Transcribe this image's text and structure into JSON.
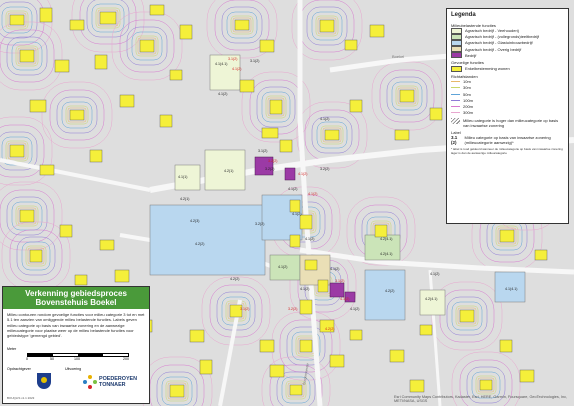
{
  "map": {
    "road_label": "Boekel",
    "street_label": "Burgemeester",
    "parcel_labels": [
      "4.1(1)",
      "4.2(1)",
      "4.2(3)",
      "3.1(2)",
      "4.1(4.1)",
      "4.1(2)",
      "4.2(2)",
      "4.1(2)",
      "4.2(4.1)",
      "4.1(2)",
      "4.1(2)",
      "3.2(2)",
      "4.1(2)",
      "4.1(2)",
      "4.1(2)",
      "4.2(4.1)",
      "4.2(4.1)",
      "4.1(2)",
      "4.1(2)",
      "4.2(2)",
      "4.1(4.1)",
      "3.2(2)",
      "3.2(2)",
      "3.1(2)",
      "4.2(1)",
      "4.1(2)",
      "4.2(2)"
    ],
    "red_labels": [
      "3.1(2)",
      "4.1(2)",
      "3.2(2)",
      "4.1(2)",
      "3.1(2)",
      "4.1(2)",
      "3.2(2)",
      "4.2(2)",
      "3.1(2)",
      "4.1(2)"
    ],
    "colors": {
      "woning": "#f5ef3a",
      "veehouderij": "#eef5d6",
      "volle_grond": "#cbe4b8",
      "glastuinbouw": "#b9d7ef",
      "overig": "#eadfb6",
      "bedrijf": "#9b3aa5",
      "c10": "#e6b96a",
      "c30": "#c8d86a",
      "c50": "#5fa4d8",
      "c100": "#8f7bd6",
      "c200": "#d77ad0",
      "c300": "#e8a7cf",
      "road": "#f6f6f6",
      "land": "#dcdcdc"
    }
  },
  "legend": {
    "title": "Legenda",
    "section1_title": "Milieubelastende functies",
    "milieu_items": [
      {
        "label": "Agrarisch bedrijf - Veehouderij",
        "color": "#eef5d6"
      },
      {
        "label": "Agrarisch bedrijf - (vollegronds)teeltbedrijf",
        "color": "#cbe4b8"
      },
      {
        "label": "Agrarisch bedrijf - Glastuinbouwbedrijf",
        "color": "#b9d7ef"
      },
      {
        "label": "Agrarisch bedrijf - Overig bedrijf",
        "color": "#eadfb6"
      },
      {
        "label": "Bedrijf",
        "color": "#9b3aa5"
      }
    ],
    "section2_title": "Gevoelige functies",
    "gevoelig_item": {
      "label": "Enkelbestemming wonen",
      "color": "#f5ef3a"
    },
    "section3_title": "Richtafstanden",
    "distances": [
      {
        "label": "10m",
        "color": "#e6b96a"
      },
      {
        "label": "30m",
        "color": "#c8d86a"
      },
      {
        "label": "50m",
        "color": "#5fa4d8"
      },
      {
        "label": "100m",
        "color": "#8f7bd6"
      },
      {
        "label": "200m",
        "color": "#d77ad0"
      },
      {
        "label": "300m",
        "color": "#e8a7cf"
      }
    ],
    "hatch_label": "Milieu categorie is hoger dan milieucategorie op basis van inwaartse zonering",
    "label_heading": "Label",
    "label_example": "3.1 (2)",
    "label_example_text": "Milieu categorie op basis van inwaartse zonering (milieucategorie aanwezig)*",
    "footnote": "* label is rood gekleurd wanneer de milieucategorie op basis van inwaartse zonering lager is dan de aanwezige milieucategorie"
  },
  "panel": {
    "title": "Verkenning gebiedsproces Bovenstehuis Boekel",
    "description": "Milieu contouren rondom gevoelige functies voor milieu categorie 3 tot en met 5.1 ten aanzien van omliggende milieu belastende functies. Labels geven milieu categorie op basis van inwaartse zonering en de aanwezige milieucategorie  voor plaatse weer op de milieu belastende functies voor gebiedstype 'gemengd gebied'.",
    "scale_label": "Meter",
    "scale_ticks": [
      "0",
      "50",
      "100",
      "200"
    ],
    "client_label": "Opdrachtgever",
    "executor_label": "Uitvoering",
    "company_name_1": "POEDEROYEN",
    "company_name_2": "TONNAER",
    "footer_code": "BOUQLIS v1.1 2023"
  },
  "credits": "Esri Community Maps Contributors, Kadaster, Esri, HERE, Garmin, Foursquare, GeoTechnologies, Inc, METI/NASA, USGS"
}
